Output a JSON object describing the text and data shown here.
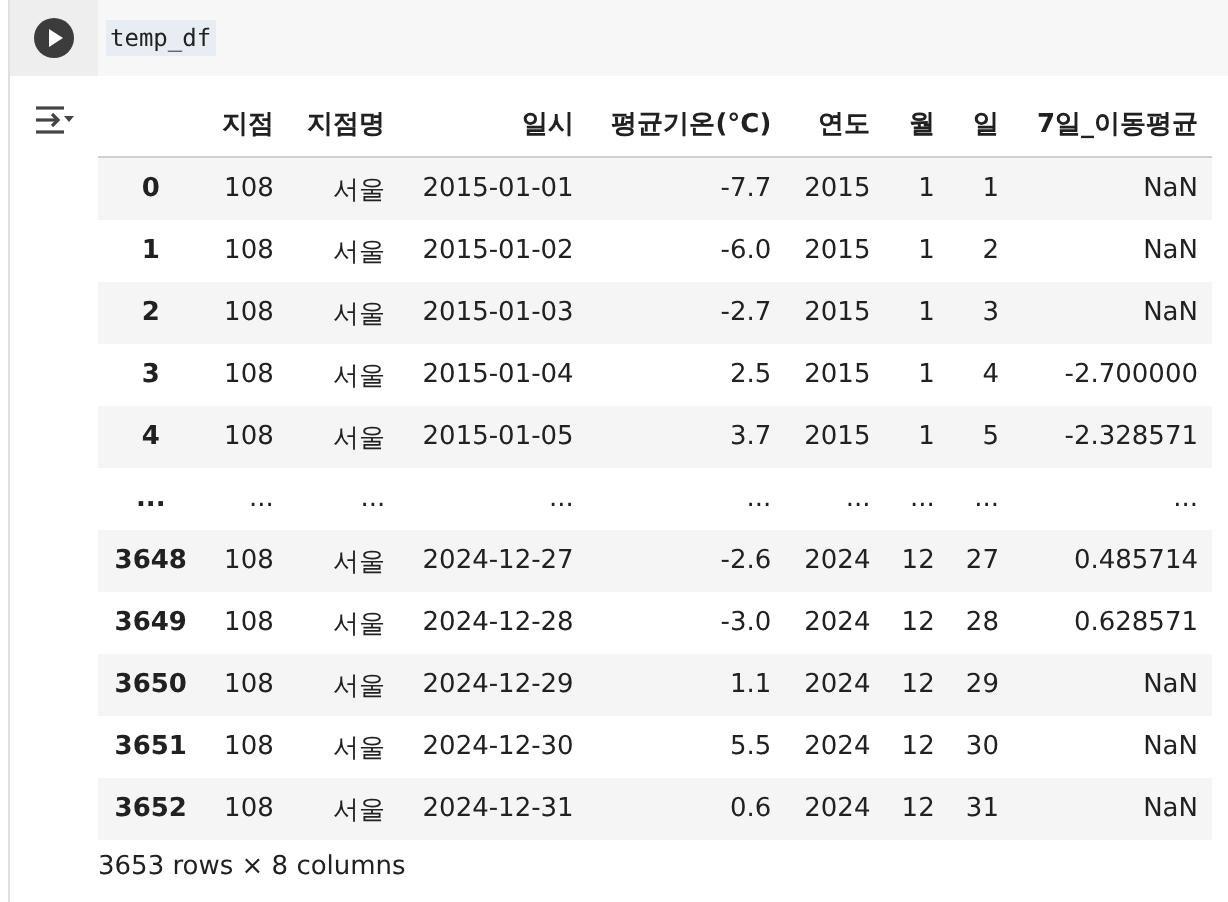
{
  "code_cell": {
    "code": "temp_df"
  },
  "table": {
    "columns": [
      "지점",
      "지점명",
      "일시",
      "평균기온(°C)",
      "연도",
      "월",
      "일",
      "7일_이동평균"
    ],
    "rows": [
      {
        "index": "0",
        "cells": [
          "108",
          "서울",
          "2015-01-01",
          "-7.7",
          "2015",
          "1",
          "1",
          "NaN"
        ]
      },
      {
        "index": "1",
        "cells": [
          "108",
          "서울",
          "2015-01-02",
          "-6.0",
          "2015",
          "1",
          "2",
          "NaN"
        ]
      },
      {
        "index": "2",
        "cells": [
          "108",
          "서울",
          "2015-01-03",
          "-2.7",
          "2015",
          "1",
          "3",
          "NaN"
        ]
      },
      {
        "index": "3",
        "cells": [
          "108",
          "서울",
          "2015-01-04",
          "2.5",
          "2015",
          "1",
          "4",
          "-2.700000"
        ]
      },
      {
        "index": "4",
        "cells": [
          "108",
          "서울",
          "2015-01-05",
          "3.7",
          "2015",
          "1",
          "5",
          "-2.328571"
        ]
      },
      {
        "index": "...",
        "cells": [
          "...",
          "...",
          "...",
          "...",
          "...",
          "...",
          "...",
          "..."
        ]
      },
      {
        "index": "3648",
        "cells": [
          "108",
          "서울",
          "2024-12-27",
          "-2.6",
          "2024",
          "12",
          "27",
          "0.485714"
        ]
      },
      {
        "index": "3649",
        "cells": [
          "108",
          "서울",
          "2024-12-28",
          "-3.0",
          "2024",
          "12",
          "28",
          "0.628571"
        ]
      },
      {
        "index": "3650",
        "cells": [
          "108",
          "서울",
          "2024-12-29",
          "1.1",
          "2024",
          "12",
          "29",
          "NaN"
        ]
      },
      {
        "index": "3651",
        "cells": [
          "108",
          "서울",
          "2024-12-30",
          "5.5",
          "2024",
          "12",
          "30",
          "NaN"
        ]
      },
      {
        "index": "3652",
        "cells": [
          "108",
          "서울",
          "2024-12-31",
          "0.6",
          "2024",
          "12",
          "31",
          "NaN"
        ]
      }
    ],
    "summary": "3653 rows × 8 columns"
  }
}
